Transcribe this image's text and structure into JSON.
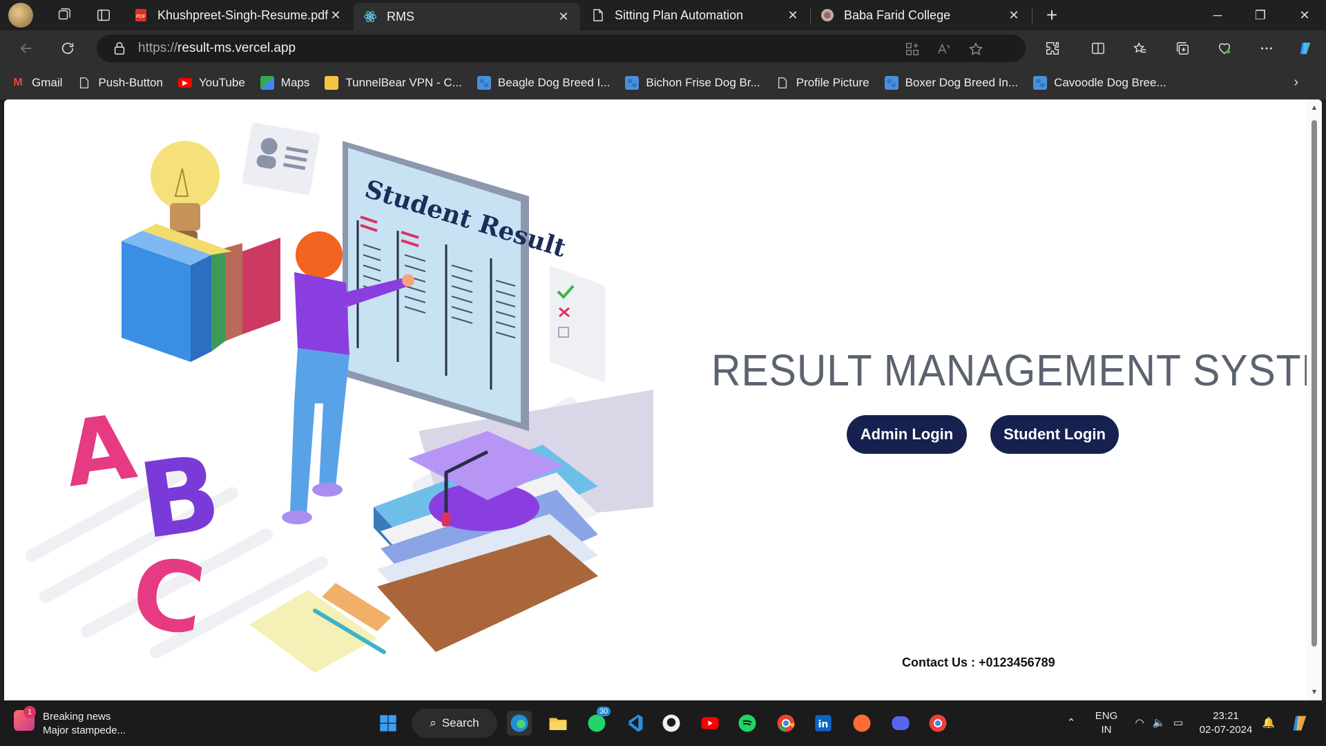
{
  "browser": {
    "tabs": [
      {
        "label": "Khushpreet-Singh-Resume.pdf",
        "icon": "pdf-icon",
        "active": false
      },
      {
        "label": "RMS",
        "icon": "react-icon",
        "active": true
      },
      {
        "label": "Sitting Plan Automation",
        "icon": "page-icon",
        "active": false
      },
      {
        "label": "Baba Farid College",
        "icon": "college-icon",
        "active": false
      }
    ],
    "url_protocol": "https://",
    "url_host": "result-ms.vercel.app",
    "bookmarks": [
      {
        "label": "Gmail",
        "icon": "gmail-icon"
      },
      {
        "label": "Push-Button",
        "icon": "page-icon"
      },
      {
        "label": "YouTube",
        "icon": "youtube-icon"
      },
      {
        "label": "Maps",
        "icon": "maps-icon"
      },
      {
        "label": "TunnelBear VPN - C...",
        "icon": "tunnelbear-icon"
      },
      {
        "label": "Beagle Dog Breed I...",
        "icon": "paw-icon"
      },
      {
        "label": "Bichon Frise Dog Br...",
        "icon": "paw-icon"
      },
      {
        "label": "Profile Picture",
        "icon": "page-icon"
      },
      {
        "label": "Boxer Dog Breed In...",
        "icon": "paw-icon"
      },
      {
        "label": "Cavoodle Dog Bree...",
        "icon": "paw-icon"
      }
    ]
  },
  "page": {
    "title": "RESULT MANAGEMENT SYSTEM",
    "admin_login": "Admin Login",
    "student_login": "Student Login",
    "contact": "Contact Us : +0123456789",
    "illustration_heading": "Student Result",
    "accent_color": "#17214f",
    "title_color": "#5b6270"
  },
  "taskbar": {
    "news_title": "Breaking news",
    "news_subtitle": "Major stampede...",
    "news_badge": "1",
    "search_label": "Search",
    "whatsapp_badge": "30",
    "lang_line1": "ENG",
    "lang_line2": "IN",
    "time": "23:21",
    "date": "02-07-2024"
  }
}
